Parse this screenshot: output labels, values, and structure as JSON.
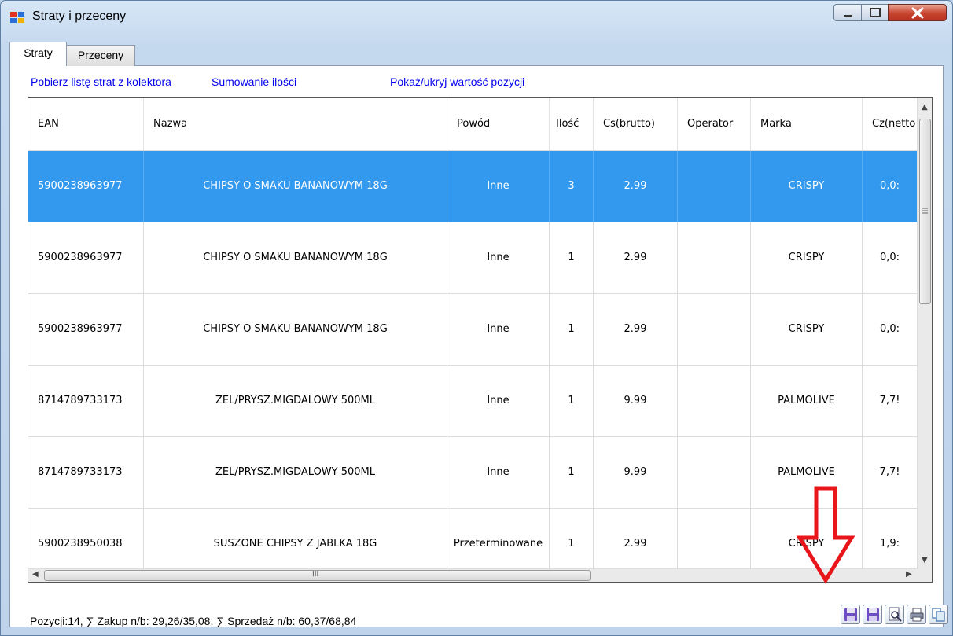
{
  "window": {
    "title": "Straty i przeceny"
  },
  "tabs": [
    {
      "label": "Straty"
    },
    {
      "label": "Przeceny"
    }
  ],
  "links": {
    "fetch_losses": "Pobierz listę strat z kolektora",
    "sum_quantity": "Sumowanie ilości",
    "toggle_value": "Pokaż/ukryj wartość pozycji"
  },
  "grid": {
    "columns": [
      "EAN",
      "Nazwa",
      "Powód",
      "Ilość",
      "Cs(brutto)",
      "Operator",
      "Marka",
      "Cz(netto"
    ],
    "rows": [
      {
        "ean": "5900238963977",
        "name": "CHIPSY O SMAKU BANANOWYM 18G",
        "reason": "Inne",
        "qty": "3",
        "price": "2.99",
        "operator": "",
        "brand": "CRISPY",
        "cost": "0,0:"
      },
      {
        "ean": "5900238963977",
        "name": "CHIPSY O SMAKU BANANOWYM 18G",
        "reason": "Inne",
        "qty": "1",
        "price": "2.99",
        "operator": "",
        "brand": "CRISPY",
        "cost": "0,0:"
      },
      {
        "ean": "5900238963977",
        "name": "CHIPSY O SMAKU BANANOWYM 18G",
        "reason": "Inne",
        "qty": "1",
        "price": "2.99",
        "operator": "",
        "brand": "CRISPY",
        "cost": "0,0:"
      },
      {
        "ean": "8714789733173",
        "name": "ZEL/PRYSZ.MIGDALOWY 500ML",
        "reason": "Inne",
        "qty": "1",
        "price": "9.99",
        "operator": "",
        "brand": "PALMOLIVE",
        "cost": "7,7!"
      },
      {
        "ean": "8714789733173",
        "name": "ZEL/PRYSZ.MIGDALOWY 500ML",
        "reason": "Inne",
        "qty": "1",
        "price": "9.99",
        "operator": "",
        "brand": "PALMOLIVE",
        "cost": "7,7!"
      },
      {
        "ean": "5900238950038",
        "name": "SUSZONE CHIPSY Z JABLKA 18G",
        "reason": "Przeterminowane",
        "qty": "1",
        "price": "2.99",
        "operator": "",
        "brand": "CRISPY",
        "cost": "1,9:"
      }
    ],
    "hscroll_grip": "III"
  },
  "status": {
    "summary": "Pozycji:14, ∑ Zakup n/b: 29,26/35,08, ∑ Sprzedaż n/b: 60,37/68,84"
  },
  "colors": {
    "selection": "#3399ee",
    "link": "#0000ee",
    "annotation_arrow": "#e8161b"
  },
  "icons": [
    "app-icon",
    "minimize-icon",
    "maximize-icon",
    "close-icon",
    "save-icon",
    "save-as-icon",
    "print-preview-icon",
    "print-icon",
    "copy-icon"
  ]
}
